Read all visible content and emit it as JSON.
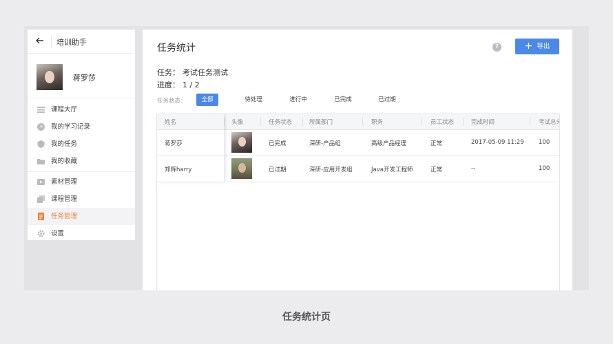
{
  "sidebar": {
    "app_title": "培训助手",
    "user_name": "蒋罗莎",
    "items": [
      {
        "label": "课程大厅",
        "icon": "list-icon"
      },
      {
        "label": "我的学习记录",
        "icon": "clock-icon"
      },
      {
        "label": "我的任务",
        "icon": "shield-icon"
      },
      {
        "label": "我的收藏",
        "icon": "folder-icon"
      },
      {
        "label": "素材管理",
        "icon": "media-icon"
      },
      {
        "label": "课程管理",
        "icon": "copy-icon"
      },
      {
        "label": "任务管理",
        "icon": "task-doc-icon",
        "active": true
      },
      {
        "label": "设置",
        "icon": "gear-icon"
      }
    ]
  },
  "main": {
    "title": "任务统计",
    "export_label": "导出",
    "task_label": "任务：",
    "task_value": "考试任务测试",
    "progress_label": "进度：",
    "progress_value": "1 / 2",
    "filter_label": "任务状态：",
    "filters": [
      "全部",
      "待处理",
      "进行中",
      "已完成",
      "已过期"
    ],
    "active_filter": "全部"
  },
  "table": {
    "columns": [
      "姓名",
      "头像",
      "任务状态",
      "所属部门",
      "职务",
      "员工状态",
      "完成时间",
      "考试总分"
    ],
    "rows": [
      {
        "name": "蒋罗莎",
        "status": "已完成",
        "dept": "深研-产品组",
        "position": "高级产品经理",
        "emp_status": "正常",
        "finish_time": "2017-05-09 11:29",
        "score": "100"
      },
      {
        "name": "郑辉harry",
        "status": "已过期",
        "dept": "深研-应用开发组",
        "position": "Java开发工程师",
        "emp_status": "正常",
        "finish_time": "--",
        "score": "100"
      }
    ]
  },
  "caption": "任务统计页",
  "colors": {
    "accent": "#4a89e8",
    "active_menu": "#f07f2e"
  }
}
